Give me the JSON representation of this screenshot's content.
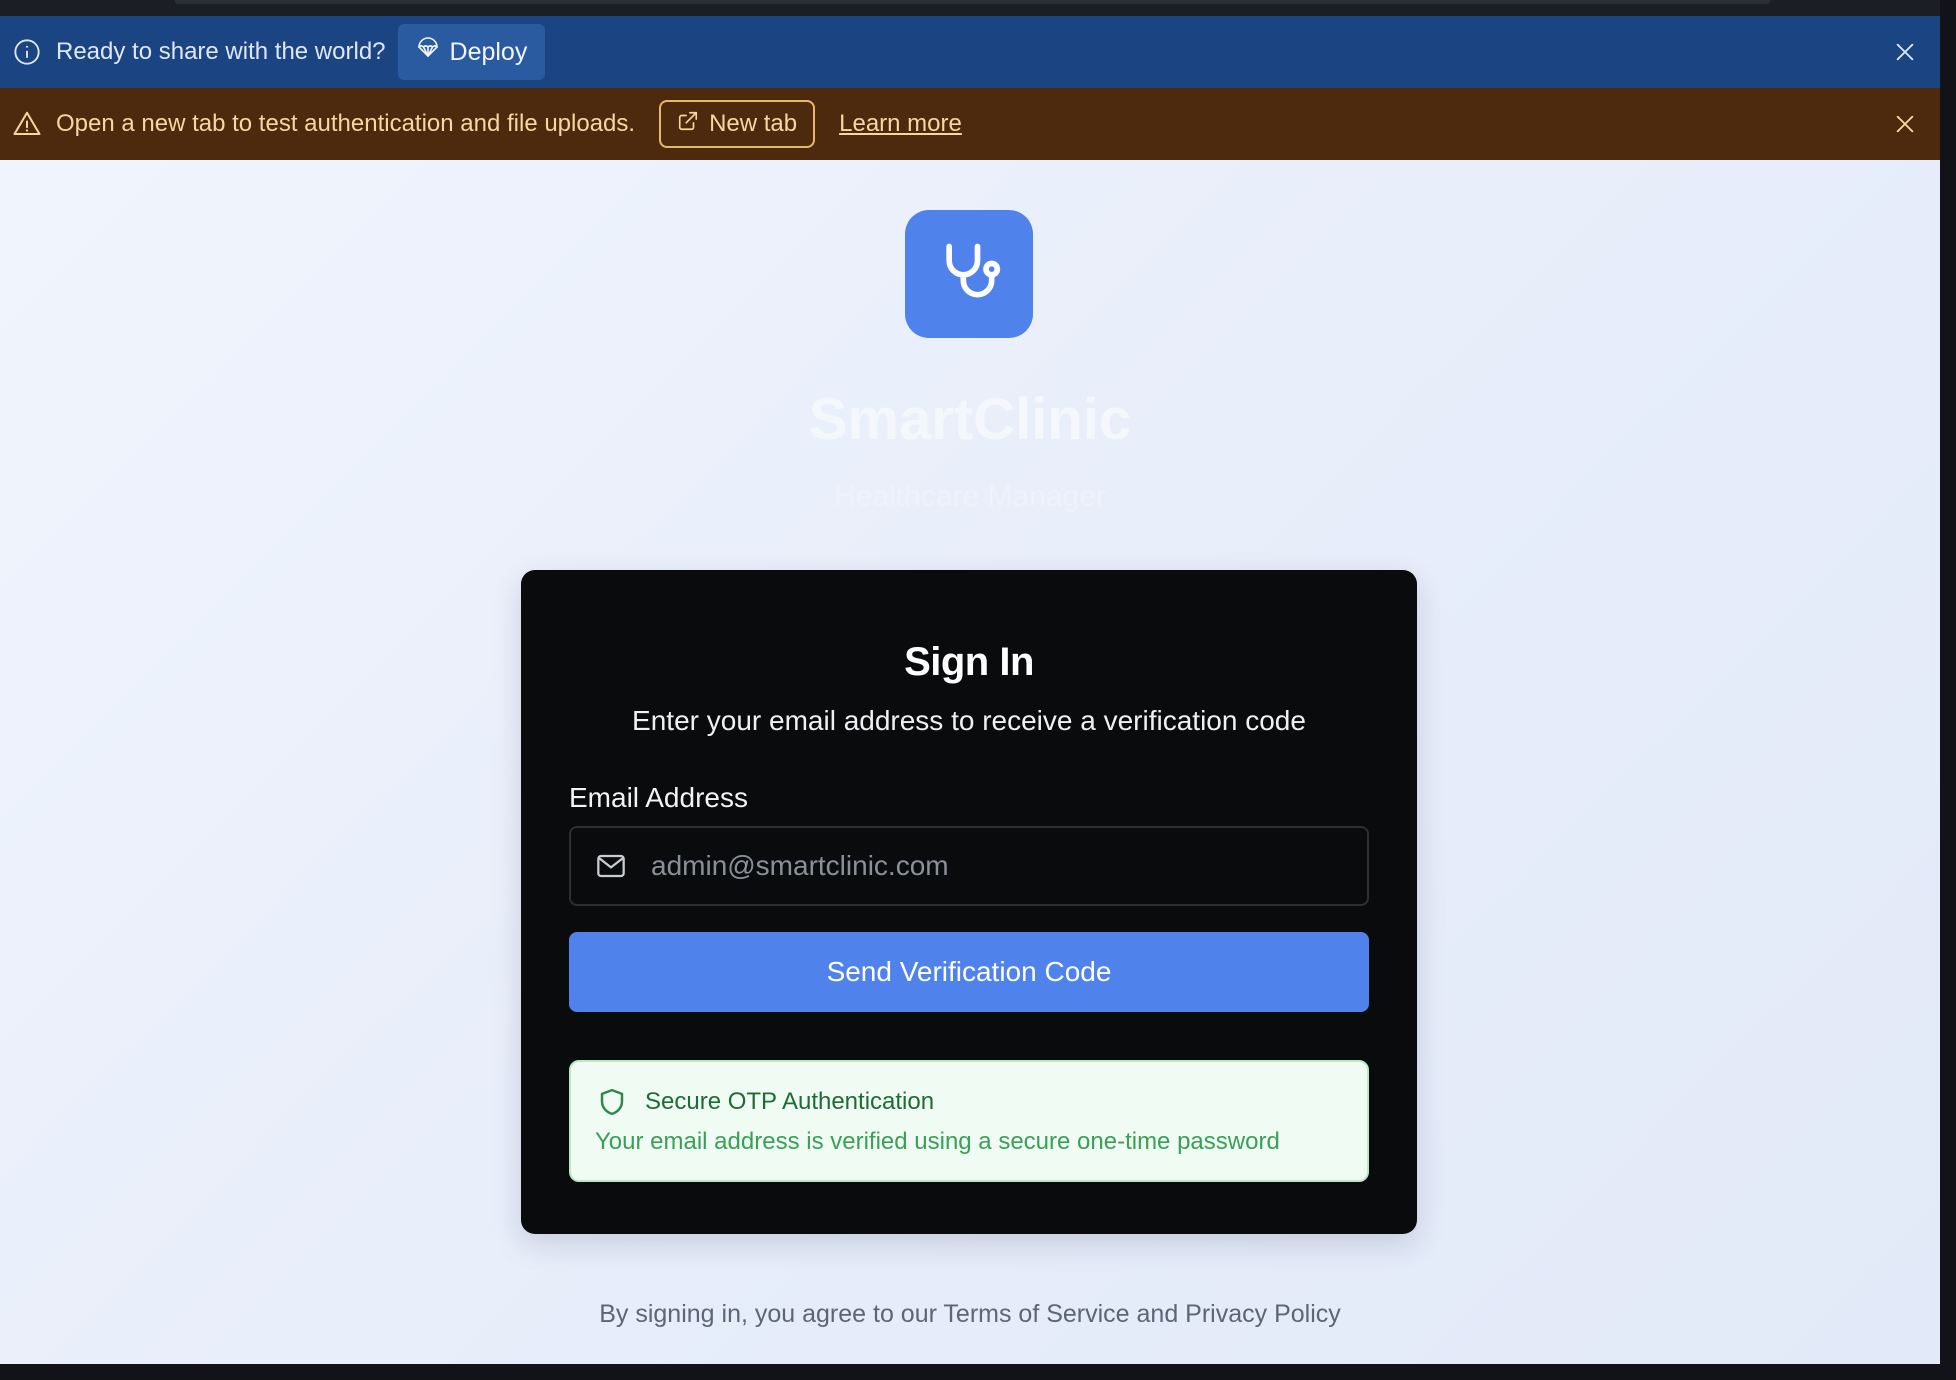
{
  "banner_deploy": {
    "text": "Ready to share with the world?",
    "button_label": "Deploy",
    "colors": {
      "background": "#1b4483",
      "button": "#2a5a9f"
    }
  },
  "banner_warning": {
    "text": "Open a new tab to test authentication and file uploads.",
    "new_tab_label": "New tab",
    "learn_more_label": "Learn more",
    "colors": {
      "background": "#4d2a0e",
      "accent": "#e8b86a"
    }
  },
  "brand": {
    "logo_icon": "stethoscope-icon",
    "title": "SmartClinic",
    "subtitle": "Healthcare Manager",
    "accent_color": "#4f82ea"
  },
  "signin": {
    "title": "Sign In",
    "subtitle": "Enter your email address to receive a verification code",
    "email_label": "Email Address",
    "email_value": "",
    "email_placeholder": "admin@smartclinic.com",
    "submit_label": "Send Verification Code",
    "secure_title": "Secure OTP Authentication",
    "secure_text": "Your email address is verified using a secure one-time password",
    "secure_colors": {
      "background": "#f0fcf3",
      "title": "#1d6b35",
      "text": "#39a057"
    }
  },
  "footer": {
    "text": "By signing in, you agree to our Terms of Service and Privacy Policy"
  }
}
